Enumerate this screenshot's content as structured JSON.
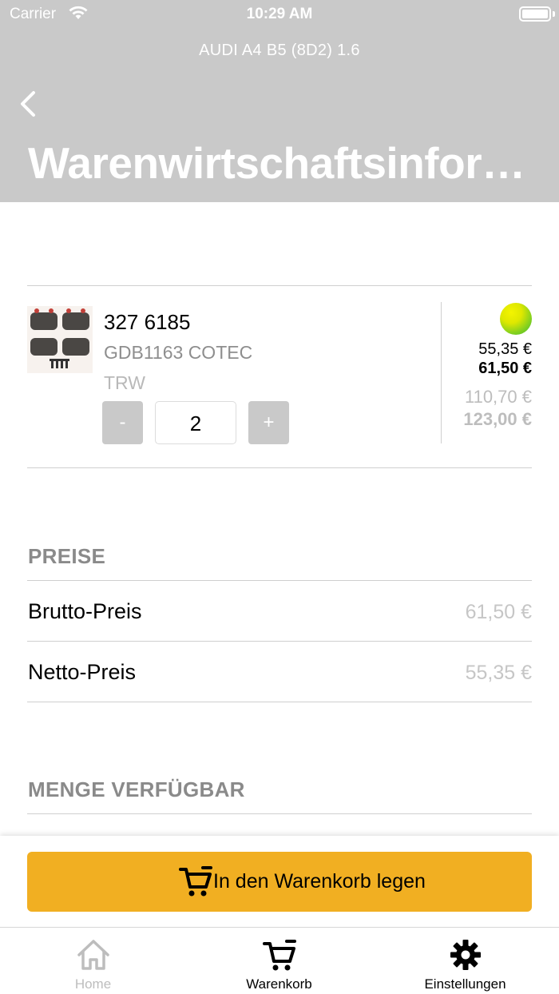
{
  "status_bar": {
    "carrier": "Carrier",
    "time": "10:29 AM"
  },
  "nav": {
    "vehicle": "AUDI A4 B5 (8D2) 1.6",
    "title": "Warenwirtschaftsinformationen"
  },
  "article": {
    "number": "327 6185",
    "description": "GDB1163 COTEC",
    "brand": "TRW",
    "quantity": "2",
    "decrement_label": "-",
    "increment_label": "+",
    "availability_color": "#7fcf20",
    "net_unit": "55,35 €",
    "gross_unit": "61,50 €",
    "net_total": "110,70 €",
    "gross_total": "123,00 €"
  },
  "prices": {
    "title": "PREISE",
    "rows": [
      {
        "label": "Brutto-Preis",
        "value": "61,50 €"
      },
      {
        "label": "Netto-Preis",
        "value": "55,35 €"
      }
    ]
  },
  "availability": {
    "title": "MENGE VERFÜGBAR"
  },
  "actions": {
    "add_to_cart": "In den Warenkorb legen",
    "accent_color": "#f1af22"
  },
  "tabs": [
    {
      "label": "Home",
      "icon": "home-icon",
      "active": false
    },
    {
      "label": "Warenkorb",
      "icon": "cart-icon",
      "active": true
    },
    {
      "label": "Einstellungen",
      "icon": "gear-icon",
      "active": true
    }
  ]
}
